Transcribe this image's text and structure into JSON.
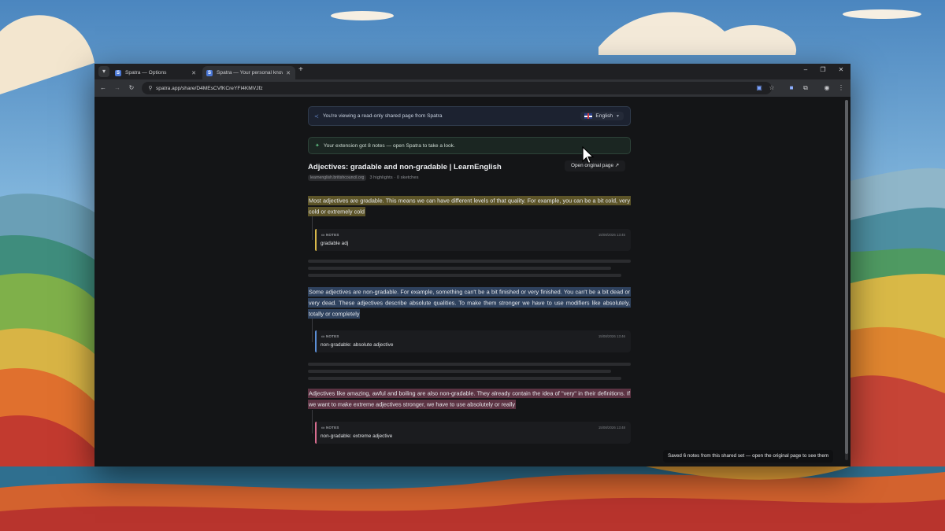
{
  "browser": {
    "tabs": [
      {
        "title": "Spatra — Options",
        "favicon": "S",
        "active": false
      },
      {
        "title": "Spatra — Your personal knowle",
        "favicon": "S",
        "active": true
      }
    ],
    "url": "spatra.app/share/D4MEsCVfKCreYFI4KMVJfz",
    "icons": {
      "tab_search": "chevron-down-icon",
      "new_tab": "plus-icon",
      "back": "arrow-left-icon",
      "forward": "arrow-right-icon",
      "reload": "reload-icon",
      "site_info": "tune-icon",
      "extension_active": "spatra-extension-icon",
      "bookmark": "star-icon",
      "extension": "spatra-icon",
      "extensions_menu": "puzzle-icon",
      "profile": "profile-icon",
      "menu": "kebab-icon",
      "minimize": "minimize-icon",
      "restore": "restore-icon",
      "close": "close-icon"
    }
  },
  "page": {
    "banner": {
      "text": "You're viewing a read-only shared page from Spatra",
      "language": "English",
      "icon": "share-icon"
    },
    "notice": {
      "text": "Your extension got 8 notes — open Spatra to take a look.",
      "icon": "sparkle-icon"
    },
    "title": "Adjectives: gradable and non-gradable | LearnEnglish",
    "open_original_label": "Open original page ↗",
    "domain": "learnenglish.britishcouncil.org",
    "stats": "3 highlights · 0 sketches",
    "highlights": [
      {
        "text": "Most adjectives are gradable. This means we can have different levels of that quality. For example, you can be a bit cold, very cold or extremely cold",
        "color": "#5c5428",
        "note": {
          "label": "NOTES",
          "date": "15/08/2026 13:45",
          "text": "gradable adj",
          "accent": "#d9b84a"
        }
      },
      {
        "text": "Some adjectives are non-gradable. For example, something can't be a bit finished or very finished. You can't be a bit dead or very dead. These adjectives describe absolute qualities. To make them stronger we have to use modifiers like absolutely, totally or completely",
        "color": "#2f425e",
        "note": {
          "label": "NOTES",
          "date": "15/08/2026 13:46",
          "text": "non-gradable: absolute adjective",
          "accent": "#5b8fd6"
        }
      },
      {
        "text": "Adjectives like amazing, awful and boiling are also non-gradable. They already contain the idea of \"very\" in their definitions. If we want to make extreme adjectives stronger, we have to use absolutely or really",
        "color": "#5c3343",
        "note": {
          "label": "NOTES",
          "date": "15/08/2026 13:48",
          "text": "non-gradable: extreme adjective",
          "accent": "#d86d8f"
        }
      }
    ],
    "toast": "Saved 6 notes from this shared set — open the original page to see them"
  }
}
